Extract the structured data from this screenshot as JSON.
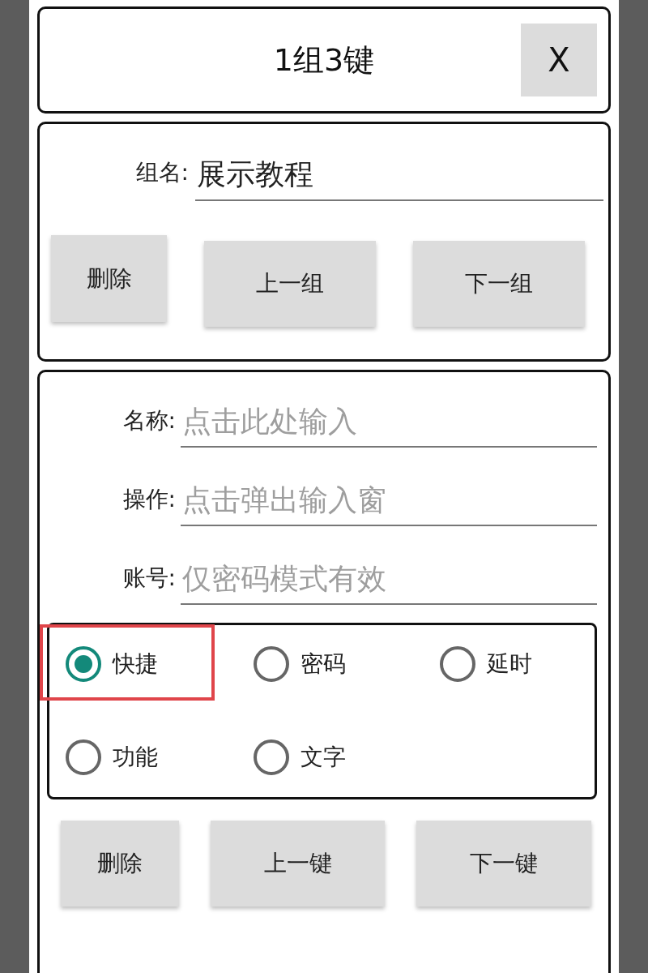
{
  "title": "1组3键",
  "close_button": "X",
  "group": {
    "label": "组名:",
    "value": "展示教程",
    "buttons": [
      "删除",
      "上一组",
      "下一组"
    ]
  },
  "key": {
    "fields": [
      {
        "label": "名称:",
        "placeholder": "点击此处输入"
      },
      {
        "label": "操作:",
        "placeholder": "点击弹出输入窗"
      },
      {
        "label": "账号:",
        "placeholder": "仅密码模式有效"
      }
    ],
    "modes": [
      {
        "label": "快捷",
        "selected": true,
        "highlighted": true
      },
      {
        "label": "密码",
        "selected": false,
        "highlighted": false
      },
      {
        "label": "延时",
        "selected": false,
        "highlighted": false
      },
      {
        "label": "功能",
        "selected": false,
        "highlighted": false
      },
      {
        "label": "文字",
        "selected": false,
        "highlighted": false
      }
    ],
    "buttons": [
      "删除",
      "上一键",
      "下一键"
    ]
  }
}
